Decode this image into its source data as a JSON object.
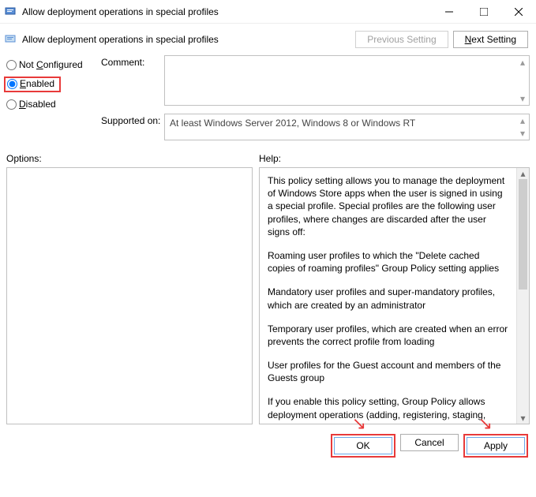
{
  "window": {
    "title": "Allow deployment operations in special profiles",
    "subtitle": "Allow deployment operations in special profiles"
  },
  "nav": {
    "previous": "Previous Setting",
    "next_prefix": "N",
    "next_rest": "ext Setting"
  },
  "radios": {
    "not_configured": {
      "u": "C",
      "pre": "Not ",
      "post": "onfigured"
    },
    "enabled": {
      "u": "E",
      "post": "nabled"
    },
    "disabled": {
      "u": "D",
      "post": "isabled"
    },
    "selected": "enabled"
  },
  "fields": {
    "comment_label": "Comment:",
    "supported_label": "Supported on:",
    "supported_value": "At least Windows Server 2012, Windows 8 or Windows RT"
  },
  "labels": {
    "options": "Options:",
    "help": "Help:"
  },
  "help": {
    "p1": "This policy setting allows you to manage the deployment of Windows Store apps when the user is signed in using a special profile. Special profiles are the following user profiles, where changes are discarded after the user signs off:",
    "p2": "Roaming user profiles to which the \"Delete cached copies of roaming profiles\" Group Policy setting applies",
    "p3": "Mandatory user profiles and super-mandatory profiles, which are created by an administrator",
    "p4": "Temporary user profiles, which are created when an error prevents the correct profile from loading",
    "p5": "User profiles for the Guest account and members of the Guests group",
    "p6": "If you enable this policy setting, Group Policy allows deployment operations (adding, registering, staging, updating, or removing an app package) of Windows Store apps when using a special"
  },
  "footer": {
    "ok": "OK",
    "cancel": "Cancel",
    "apply": "Apply"
  }
}
